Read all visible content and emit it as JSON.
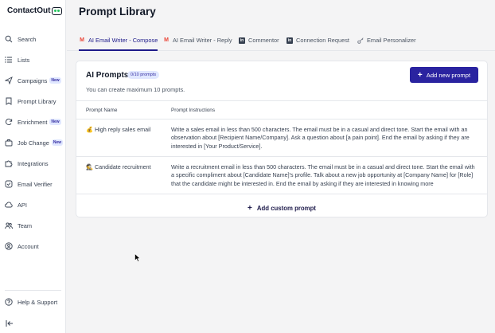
{
  "app": {
    "logo_text": "ContactOut",
    "page_title": "Prompt Library"
  },
  "sidebar": {
    "items": [
      {
        "label": "Search",
        "icon": "search-icon",
        "badge": ""
      },
      {
        "label": "Lists",
        "icon": "list-icon",
        "badge": ""
      },
      {
        "label": "Campaigns",
        "icon": "send-icon",
        "badge": "New"
      },
      {
        "label": "Prompt Library",
        "icon": "bookmark-icon",
        "badge": ""
      },
      {
        "label": "Enrichment",
        "icon": "refresh-icon",
        "badge": "New"
      },
      {
        "label": "Job Change",
        "icon": "briefcase-icon",
        "badge": "New"
      },
      {
        "label": "Integrations",
        "icon": "puzzle-icon",
        "badge": ""
      },
      {
        "label": "Email Verifier",
        "icon": "check-circle-icon",
        "badge": ""
      },
      {
        "label": "API",
        "icon": "cloud-icon",
        "badge": ""
      },
      {
        "label": "Team",
        "icon": "users-icon",
        "badge": ""
      },
      {
        "label": "Account",
        "icon": "user-circle-icon",
        "badge": ""
      }
    ],
    "footer": [
      {
        "label": "Help & Support",
        "icon": "help-circle-icon"
      }
    ]
  },
  "tabs": [
    {
      "label": "AI Email Writer - Compose",
      "icon": "gmail-icon",
      "active": true
    },
    {
      "label": "AI Email Writer - Reply",
      "icon": "gmail-icon",
      "active": false
    },
    {
      "label": "Commentor",
      "icon": "linkedin-icon",
      "active": false
    },
    {
      "label": "Connection Request",
      "icon": "linkedin-icon",
      "active": false
    },
    {
      "label": "Email Personalizer",
      "icon": "key-icon",
      "active": false
    }
  ],
  "prompts_card": {
    "title": "AI Prompts",
    "count_badge": "0/10 prompts",
    "subtitle": "You can create maximum 10 prompts.",
    "add_button": "Add new prompt",
    "columns": [
      "Prompt Name",
      "Prompt Instructions"
    ],
    "rows": [
      {
        "emoji": "💰",
        "name": "High reply sales email",
        "instructions": "Write a sales email in less than 500 characters. The email must be in a casual and direct tone. Start the email with an observation about [Recipient Name/Company]. Ask a question about [a pain point]. End the email by asking if they are interested in [Your Product/Service]."
      },
      {
        "emoji": "🕵",
        "name": "Candidate recruitment",
        "instructions": "Write a recruitment email in less than 500 characters. The email must be in a casual and direct tone. Start the email with a specific compliment about [Candidate Name]'s profile. Talk about a new job opportunity at [Company Name] for [Role] that the candidate might be interested in. End the email by asking if they are interested in knowing more"
      }
    ],
    "custom_button": "Add custom prompt"
  },
  "colors": {
    "accent": "#2a23a0",
    "badge_bg": "#e0e7ff",
    "logo_dot": "#22c55e"
  }
}
